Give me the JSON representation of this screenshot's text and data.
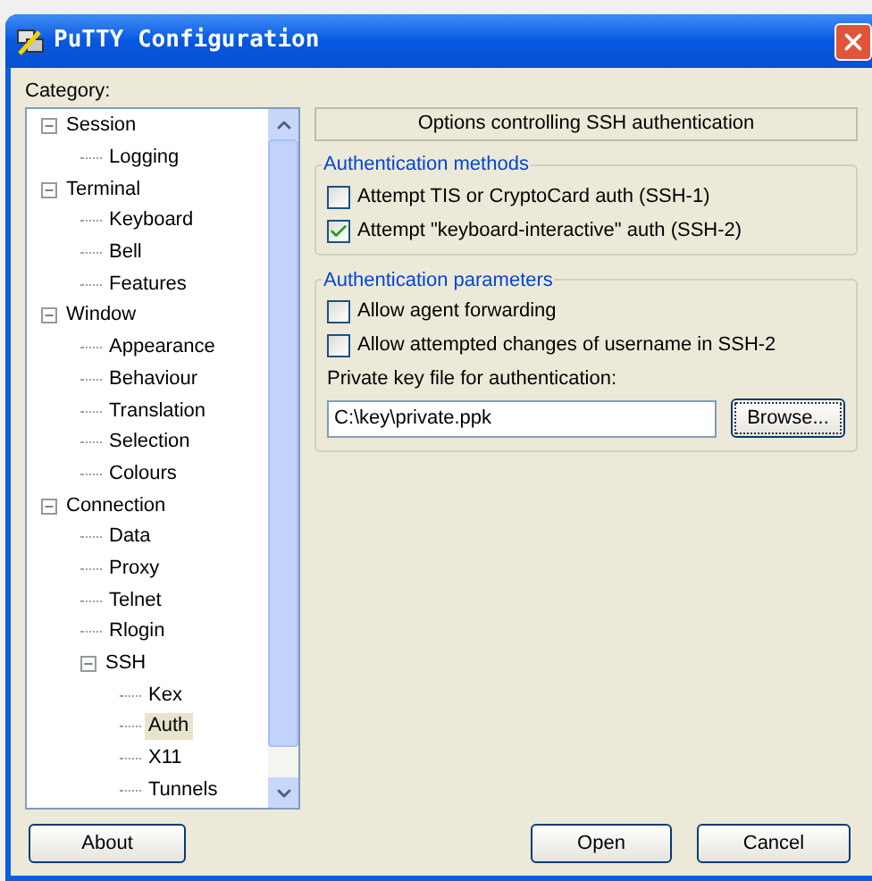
{
  "window": {
    "title": "PuTTY Configuration"
  },
  "category_label": "Category:",
  "tree": [
    {
      "label": "Session",
      "selected": false,
      "expanded": true,
      "children": [
        {
          "label": "Logging",
          "selected": false
        }
      ]
    },
    {
      "label": "Terminal",
      "selected": false,
      "expanded": true,
      "children": [
        {
          "label": "Keyboard",
          "selected": false
        },
        {
          "label": "Bell",
          "selected": false
        },
        {
          "label": "Features",
          "selected": false
        }
      ]
    },
    {
      "label": "Window",
      "selected": false,
      "expanded": true,
      "children": [
        {
          "label": "Appearance",
          "selected": false
        },
        {
          "label": "Behaviour",
          "selected": false
        },
        {
          "label": "Translation",
          "selected": false
        },
        {
          "label": "Selection",
          "selected": false
        },
        {
          "label": "Colours",
          "selected": false
        }
      ]
    },
    {
      "label": "Connection",
      "selected": false,
      "expanded": true,
      "children": [
        {
          "label": "Data",
          "selected": false
        },
        {
          "label": "Proxy",
          "selected": false
        },
        {
          "label": "Telnet",
          "selected": false
        },
        {
          "label": "Rlogin",
          "selected": false
        },
        {
          "label": "SSH",
          "selected": false,
          "expanded": true,
          "children": [
            {
              "label": "Kex",
              "selected": false
            },
            {
              "label": "Auth",
              "selected": true
            },
            {
              "label": "X11",
              "selected": false
            },
            {
              "label": "Tunnels",
              "selected": false
            }
          ]
        }
      ]
    }
  ],
  "panel_title": "Options controlling SSH authentication",
  "groups": [
    {
      "title": "Authentication methods",
      "items": [
        {
          "kind": "checkbox",
          "label": "Attempt TIS or CryptoCard auth (SSH-1)",
          "checked": false
        },
        {
          "kind": "checkbox",
          "label": "Attempt \"keyboard-interactive\" auth (SSH-2)",
          "checked": true
        }
      ]
    },
    {
      "title": "Authentication parameters",
      "items": [
        {
          "kind": "checkbox",
          "label": "Allow agent forwarding",
          "checked": false
        },
        {
          "kind": "checkbox",
          "label": "Allow attempted changes of username in SSH-2",
          "checked": false
        },
        {
          "kind": "label",
          "label": "Private key file for authentication:"
        },
        {
          "kind": "file",
          "value": "C:\\key\\private.ppk",
          "button": "Browse..."
        }
      ]
    }
  ],
  "buttons": [
    {
      "label": "About"
    },
    {
      "label": "Open"
    },
    {
      "label": "Cancel"
    }
  ]
}
